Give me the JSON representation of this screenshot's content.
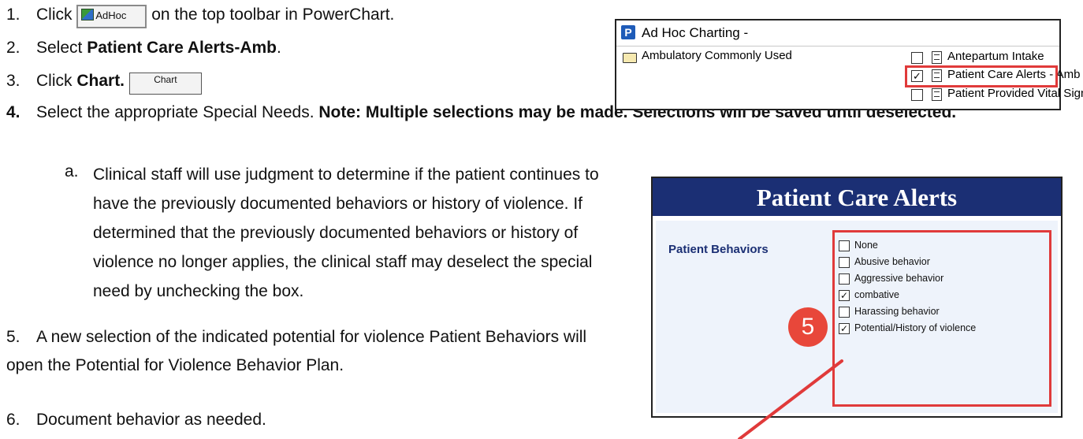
{
  "steps": {
    "s1": {
      "num": "1.",
      "pre": "Click",
      "button": "AdHoc",
      "post": "on the top toolbar in PowerChart."
    },
    "s2": {
      "num": "2.",
      "pre": "Select ",
      "bold": "Patient Care Alerts-Amb",
      "post": "."
    },
    "s3": {
      "num": "3.",
      "pre": "Click ",
      "bold": "Chart.",
      "button": "Chart"
    },
    "s4": {
      "num": "4.",
      "pre": "Select the appropriate Special Needs. ",
      "bold": "Note: Multiple selections may be made. Selections will be saved until deselected."
    },
    "s4a": {
      "letter": "a.",
      "text": "Clinical staff will use judgment to determine if the patient continues to have the previously documented behaviors or history of violence. If determined that the previously documented behaviors or history of violence no longer applies, the clinical staff may deselect the special need by unchecking the box."
    },
    "s5": {
      "num": "5.",
      "text": "A new selection of the indicated potential for violence Patient Behaviors will open the Potential for Violence Behavior Plan."
    },
    "s6": {
      "num": "6.",
      "text": "Document behavior as needed."
    }
  },
  "adhoc_panel": {
    "title": "Ad Hoc Charting -",
    "logo": "P",
    "folder": "Ambulatory Commonly Used",
    "items": [
      {
        "label": "Antepartum Intake",
        "checked": false
      },
      {
        "label": "Patient Care Alerts - Amb",
        "checked": true
      },
      {
        "label": "Patient Provided Vital Signs",
        "checked": false
      }
    ]
  },
  "pca_panel": {
    "title": "Patient Care Alerts",
    "section_label": "Patient Behaviors",
    "badge": "5",
    "items": [
      {
        "label": "None",
        "checked": false
      },
      {
        "label": "Abusive behavior",
        "checked": false
      },
      {
        "label": "Aggressive behavior",
        "checked": false
      },
      {
        "label": "combative",
        "checked": true
      },
      {
        "label": "Harassing behavior",
        "checked": false
      },
      {
        "label": "Potential/History of violence",
        "checked": true
      }
    ]
  },
  "colors": {
    "accent_red": "#e03a3a",
    "header_navy": "#1b2f74",
    "badge_red": "#e8473a"
  }
}
